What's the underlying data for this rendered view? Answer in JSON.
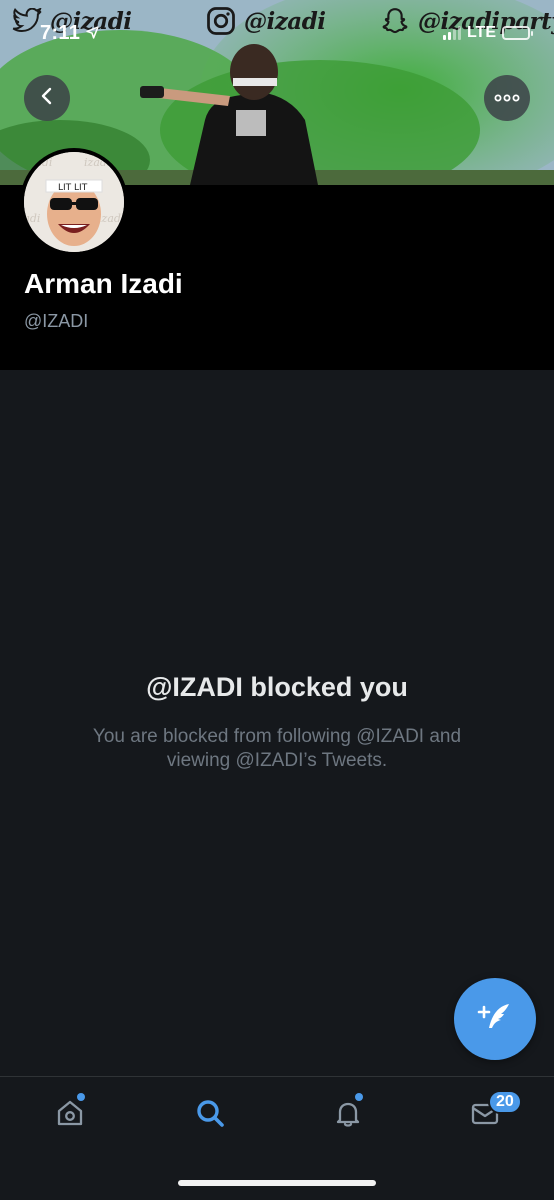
{
  "status_bar": {
    "time": "7:11",
    "network": "LTE",
    "battery_color": "#ffcc00"
  },
  "banner": {
    "social": [
      {
        "icon": "twitter-icon",
        "label": "@izadi"
      },
      {
        "icon": "instagram-icon",
        "label": "@izadi"
      },
      {
        "icon": "snapchat-icon",
        "label": "@izadiparty"
      }
    ]
  },
  "nav": {
    "back_icon": "chevron-left-icon",
    "more_icon": "more-horizontal-icon"
  },
  "profile": {
    "display_name": "Arman Izadi",
    "handle": "@IZADI"
  },
  "blocked": {
    "title": "@IZADI blocked you",
    "description": "You are blocked from following @IZADI and viewing @IZADI’s Tweets."
  },
  "compose": {
    "icon": "compose-tweet-icon",
    "color": "#4a99e9"
  },
  "tabbar": {
    "tabs": [
      {
        "name": "home",
        "icon": "home-icon",
        "active": false,
        "has_dot": true
      },
      {
        "name": "search",
        "icon": "search-icon",
        "active": true,
        "has_dot": false
      },
      {
        "name": "notifications",
        "icon": "bell-icon",
        "active": false,
        "has_dot": true
      },
      {
        "name": "messages",
        "icon": "mail-icon",
        "active": false,
        "badge": "20"
      }
    ],
    "accent": "#4a99e9"
  }
}
